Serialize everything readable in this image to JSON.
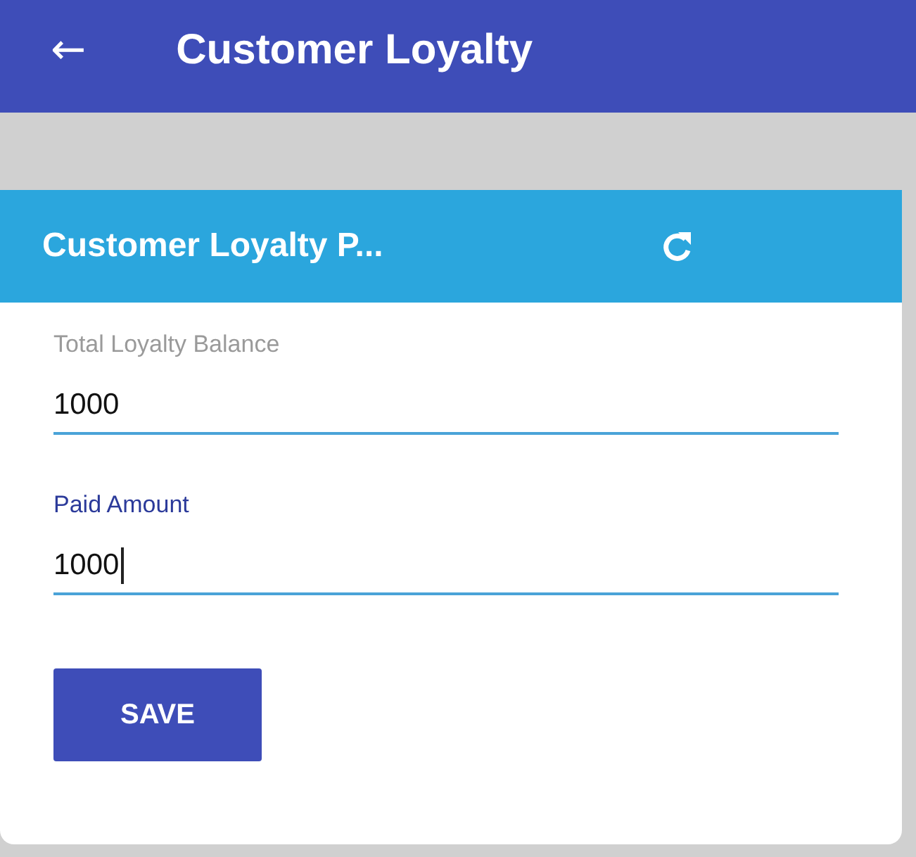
{
  "app_bar": {
    "back_icon": "←",
    "title": "Customer Loyalty"
  },
  "card": {
    "title": "Customer Loyalty P...",
    "fields": [
      {
        "label": "Total Loyalty Balance",
        "value": "1000",
        "focused": false
      },
      {
        "label": "Paid Amount",
        "value": "1000",
        "focused": true
      }
    ],
    "save_button": "SAVE"
  }
}
